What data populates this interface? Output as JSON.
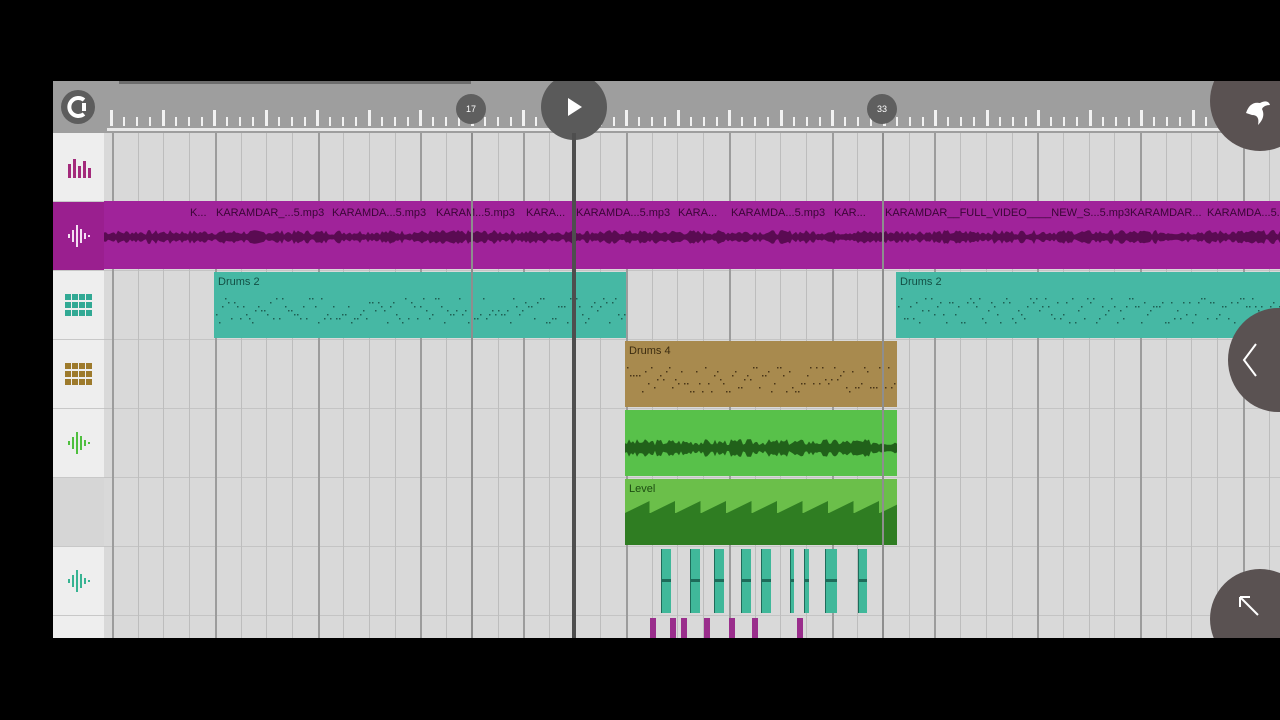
{
  "colors": {
    "audio_track": "#a0239a",
    "drums2": "#46b8a4",
    "drums4": "#a88a4e",
    "audio_green": "#58c14a",
    "automation": "#6bbf4a",
    "automation_dark": "#2f7d22",
    "hits_teal": "#40b89a",
    "hits_magenta": "#9a2e8c"
  },
  "timeline": {
    "marker_17": "17",
    "marker_33": "33"
  },
  "toolbar": {
    "snap_icon": "magnet-icon",
    "play_icon": "play-icon",
    "menu_icon": "app-logo-icon",
    "collapse_icon": "chevron-left-icon",
    "expand_icon": "expand-arrow-icon"
  },
  "tracks": [
    {
      "icon": "mixer-icon"
    },
    {
      "icon": "waveform-icon"
    },
    {
      "icon": "drum-pads-icon"
    },
    {
      "icon": "drum-pads-icon"
    },
    {
      "icon": "waveform-icon"
    },
    {
      "icon": "empty"
    },
    {
      "icon": "waveform-icon"
    }
  ],
  "audio_labels": [
    "K...",
    "KARAMDAR_...5.mp3",
    "KARAMDA...5.mp3",
    "KARAM...5.mp3",
    "KARA...",
    "KARAMDA...5.mp3",
    "KARA...",
    "KARAMDA...5.mp3",
    "KAR...",
    "KARAMDAR__FULL_VIDEO____NEW_S...5.mp3",
    "KARAMDAR...",
    "KARAMDA...5."
  ],
  "clips": {
    "drums2_a": "Drums 2",
    "drums2_b": "Drums 2",
    "drums4": "Drums 4",
    "level": "Level"
  }
}
